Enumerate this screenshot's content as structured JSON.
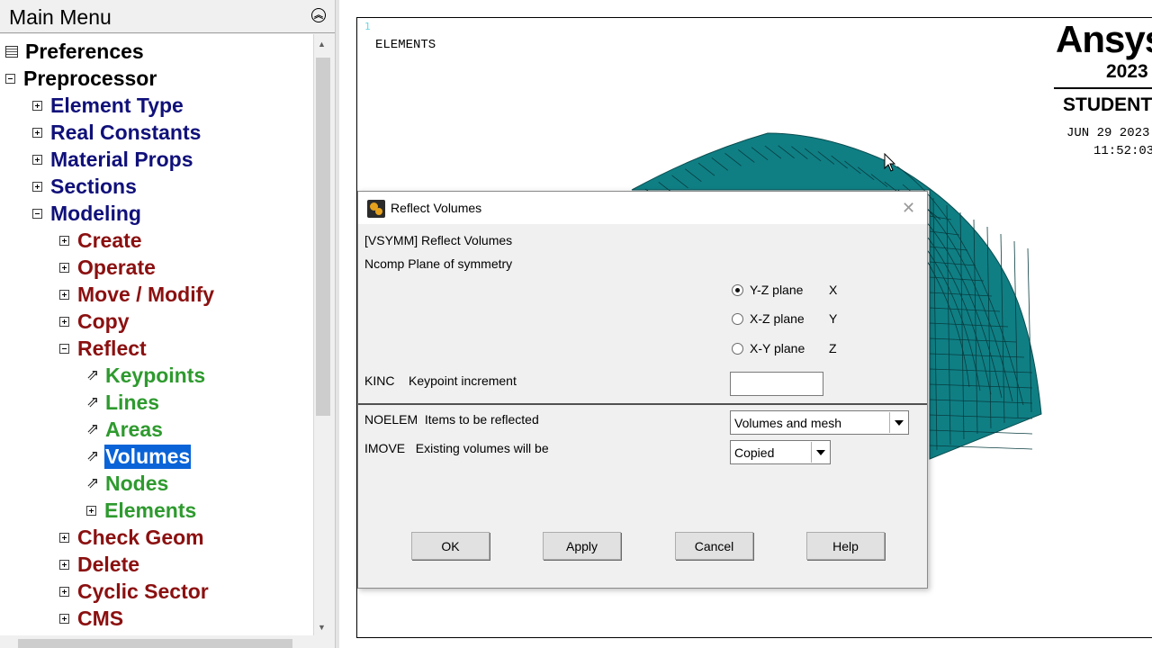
{
  "menu": {
    "title": "Main Menu",
    "items": [
      {
        "label": "Preferences",
        "level": 0,
        "kind": "prefs",
        "color": "black"
      },
      {
        "label": "Preprocessor",
        "level": 0,
        "kind": "minus",
        "color": "black"
      },
      {
        "label": "Element Type",
        "level": 1,
        "kind": "plus",
        "color": "navy"
      },
      {
        "label": "Real Constants",
        "level": 1,
        "kind": "plus",
        "color": "navy"
      },
      {
        "label": "Material Props",
        "level": 1,
        "kind": "plus",
        "color": "navy"
      },
      {
        "label": "Sections",
        "level": 1,
        "kind": "plus",
        "color": "navy"
      },
      {
        "label": "Modeling",
        "level": 1,
        "kind": "minus",
        "color": "navy"
      },
      {
        "label": "Create",
        "level": 2,
        "kind": "plus",
        "color": "red"
      },
      {
        "label": "Operate",
        "level": 2,
        "kind": "plus",
        "color": "red"
      },
      {
        "label": "Move / Modify",
        "level": 2,
        "kind": "plus",
        "color": "red"
      },
      {
        "label": "Copy",
        "level": 2,
        "kind": "plus",
        "color": "red"
      },
      {
        "label": "Reflect",
        "level": 2,
        "kind": "minus",
        "color": "red"
      },
      {
        "label": "Keypoints",
        "level": 3,
        "kind": "arrow",
        "color": "green"
      },
      {
        "label": "Lines",
        "level": 3,
        "kind": "arrow",
        "color": "green"
      },
      {
        "label": "Areas",
        "level": 3,
        "kind": "arrow",
        "color": "green"
      },
      {
        "label": "Volumes",
        "level": 3,
        "kind": "arrow",
        "color": "green",
        "selected": true
      },
      {
        "label": "Nodes",
        "level": 3,
        "kind": "arrow",
        "color": "green"
      },
      {
        "label": "Elements",
        "level": 3,
        "kind": "plus",
        "color": "green"
      },
      {
        "label": "Check Geom",
        "level": 2,
        "kind": "plus",
        "color": "red"
      },
      {
        "label": "Delete",
        "level": 2,
        "kind": "plus",
        "color": "red"
      },
      {
        "label": "Cyclic Sector",
        "level": 2,
        "kind": "plus",
        "color": "red"
      },
      {
        "label": "CMS",
        "level": 2,
        "kind": "plus",
        "color": "red"
      }
    ]
  },
  "graphics": {
    "window_number": "1",
    "label": "ELEMENTS",
    "logo": {
      "brand": "Ansys",
      "year": "2023",
      "edition": "STUDENT"
    },
    "date": "JUN 29 2023",
    "time": "11:52:03",
    "mesh_color": "#0f7f84"
  },
  "dialog": {
    "title": "Reflect Volumes",
    "command_line": "[VSYMM]  Reflect Volumes",
    "ncomp_label": "Ncomp  Plane of symmetry",
    "planes": [
      {
        "label": "Y-Z plane",
        "axis": "X",
        "selected": true
      },
      {
        "label": "X-Z plane",
        "axis": "Y",
        "selected": false
      },
      {
        "label": "X-Y plane",
        "axis": "Z",
        "selected": false
      }
    ],
    "kinc_label": "KINC    Keypoint increment",
    "kinc_value": "",
    "noelem_label": "NOELEM  Items to be reflected",
    "noelem_value": "Volumes and mesh",
    "imove_label": "IMOVE   Existing volumes will be",
    "imove_value": "Copied",
    "buttons": {
      "ok": "OK",
      "apply": "Apply",
      "cancel": "Cancel",
      "help": "Help"
    }
  }
}
